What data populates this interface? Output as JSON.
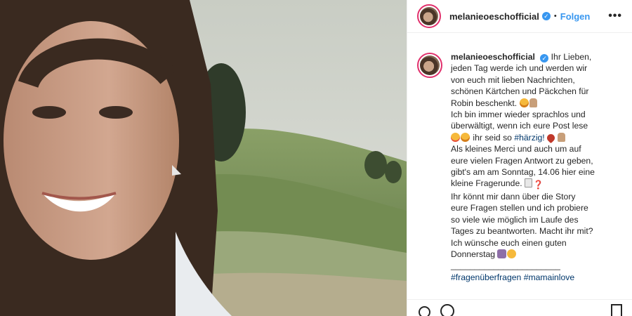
{
  "post": {
    "username": "melanieoeschofficial",
    "follow_label": "Folgen",
    "more_label": "•••",
    "verified_glyph": "✓",
    "dot": "•"
  },
  "caption": {
    "username": "melanieoeschofficial",
    "lines": [
      "Ihr Lieben,",
      "jeden Tag werde ich und werden wir",
      "von euch mit lieben Nachrichten,",
      "schönen Kärtchen und Päckchen für",
      "Robin beschenkt.",
      "Ich bin immer wieder sprachlos und",
      "überwältigt, wenn ich eure Post lese",
      "ihr seid so",
      "#härzig!",
      "Als kleines Merci und auch um auf",
      "eure vielen Fragen Antwort zu geben,",
      "gibt's am am Sonntag, 14.06 hier eine",
      "kleine Fragerunde.",
      "Ihr könnt mir dann über die Story",
      "eure Fragen stellen und ich probiere",
      "so viele wie möglich im Laufe des",
      "Tages zu beantworten. Macht ihr mit?",
      "Ich wünsche euch einen guten",
      "Donnerstag",
      "_______________________",
      "#fragenüberfragen",
      "#mamainlove"
    ],
    "question_glyph": "❓"
  },
  "icons": {
    "avatar": "avatar-photo",
    "verified": "verified-badge-icon",
    "like": "heart-outline-icon",
    "comment": "comment-bubble-icon",
    "save": "bookmark-icon"
  }
}
